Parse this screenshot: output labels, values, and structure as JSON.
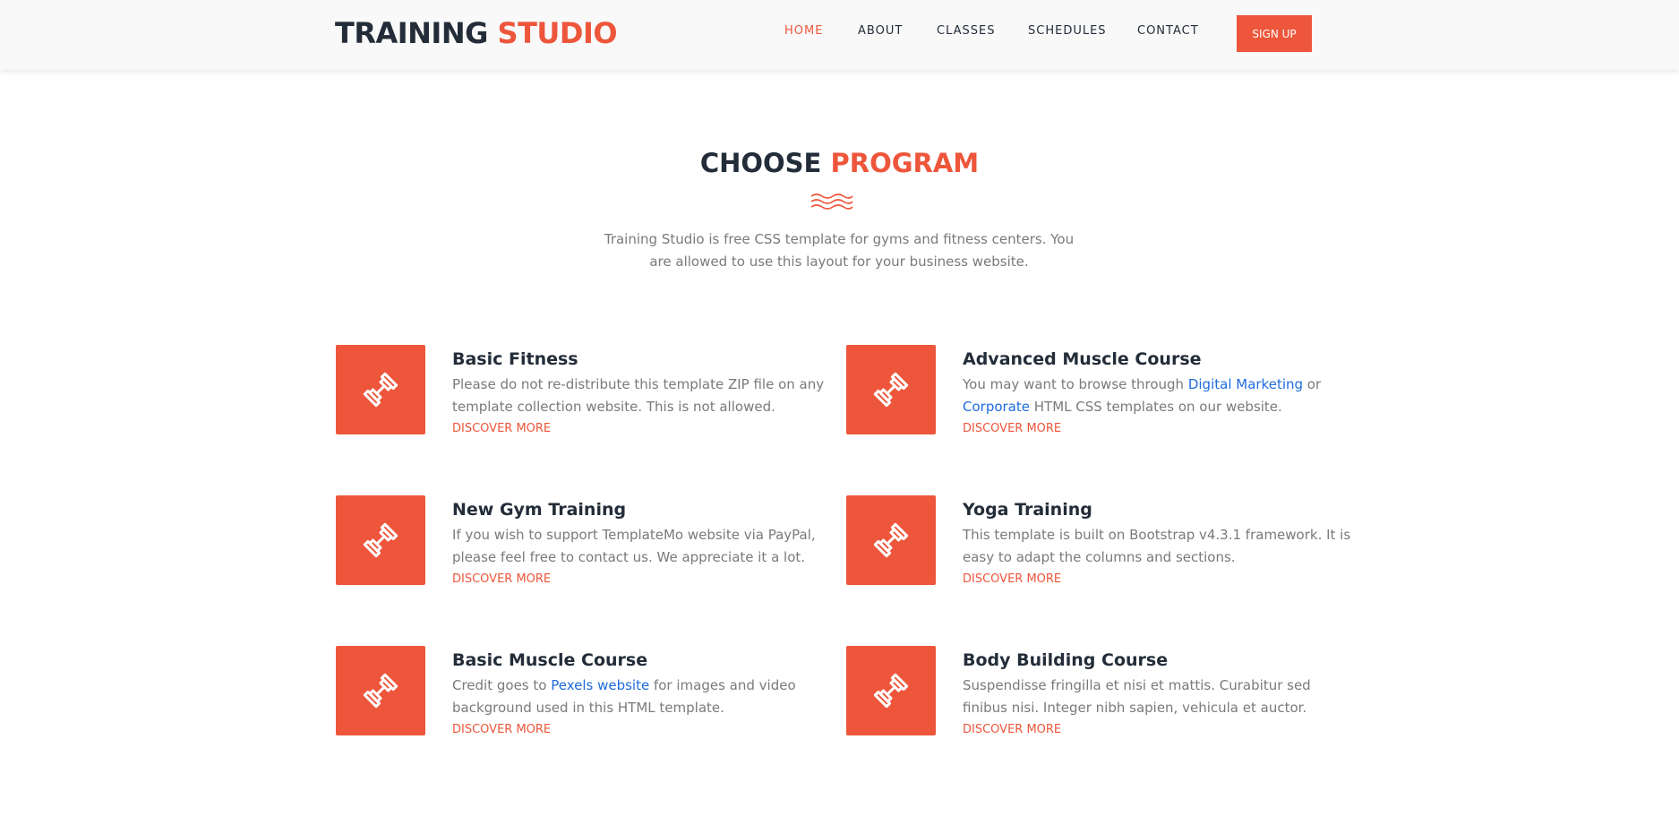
{
  "header": {
    "logo_main": "TRAINING",
    "logo_accent": "STUDIO",
    "nav": [
      {
        "label": "HOME",
        "active": true
      },
      {
        "label": "ABOUT",
        "active": false
      },
      {
        "label": "CLASSES",
        "active": false
      },
      {
        "label": "SCHEDULES",
        "active": false
      },
      {
        "label": "CONTACT",
        "active": false
      }
    ],
    "signup_label": "SIGN UP"
  },
  "section": {
    "title_main": "CHOOSE",
    "title_accent": "PROGRAM",
    "description": "Training Studio is free CSS template for gyms and fitness centers. You are allowed to use this layout for your business website."
  },
  "programs": [
    {
      "title": "Basic Fitness",
      "desc_before": "Please do not re-distribute this template ZIP file on any template collection website. This is not allowed.",
      "link1": "",
      "desc_mid": "",
      "link2": "",
      "desc_after": "",
      "more": "DISCOVER MORE",
      "icon": "dumbbell-icon"
    },
    {
      "title": "Advanced Muscle Course",
      "desc_before": "You may want to browse through ",
      "link1": "Digital Marketing",
      "desc_mid": " or ",
      "link2": "Corporate",
      "desc_after": " HTML CSS templates on our website.",
      "more": "DISCOVER MORE",
      "icon": "dumbbell-icon"
    },
    {
      "title": "New Gym Training",
      "desc_before": "If you wish to support TemplateMo website via PayPal, please feel free to contact us. We appreciate it a lot.",
      "link1": "",
      "desc_mid": "",
      "link2": "",
      "desc_after": "",
      "more": "DISCOVER MORE",
      "icon": "dumbbell-icon"
    },
    {
      "title": "Yoga Training",
      "desc_before": "This template is built on Bootstrap v4.3.1 framework. It is easy to adapt the columns and sections.",
      "link1": "",
      "desc_mid": "",
      "link2": "",
      "desc_after": "",
      "more": "DISCOVER MORE",
      "icon": "dumbbell-icon"
    },
    {
      "title": "Basic Muscle Course",
      "desc_before": "Credit goes to ",
      "link1": "Pexels website",
      "desc_mid": " for images and video background used in this HTML template.",
      "link2": "",
      "desc_after": "",
      "more": "DISCOVER MORE",
      "icon": "dumbbell-icon"
    },
    {
      "title": "Body Building Course",
      "desc_before": "Suspendisse fringilla et nisi et mattis. Curabitur sed finibus nisi. Integer nibh sapien, vehicula et auctor.",
      "link1": "",
      "desc_mid": "",
      "link2": "",
      "desc_after": "",
      "more": "DISCOVER MORE",
      "icon": "dumbbell-icon"
    }
  ],
  "colors": {
    "accent": "#ed563b",
    "dark": "#232d39",
    "text": "#7a7a7a",
    "link": "#1e6bdc",
    "header_bg": "#f9f9fa"
  }
}
